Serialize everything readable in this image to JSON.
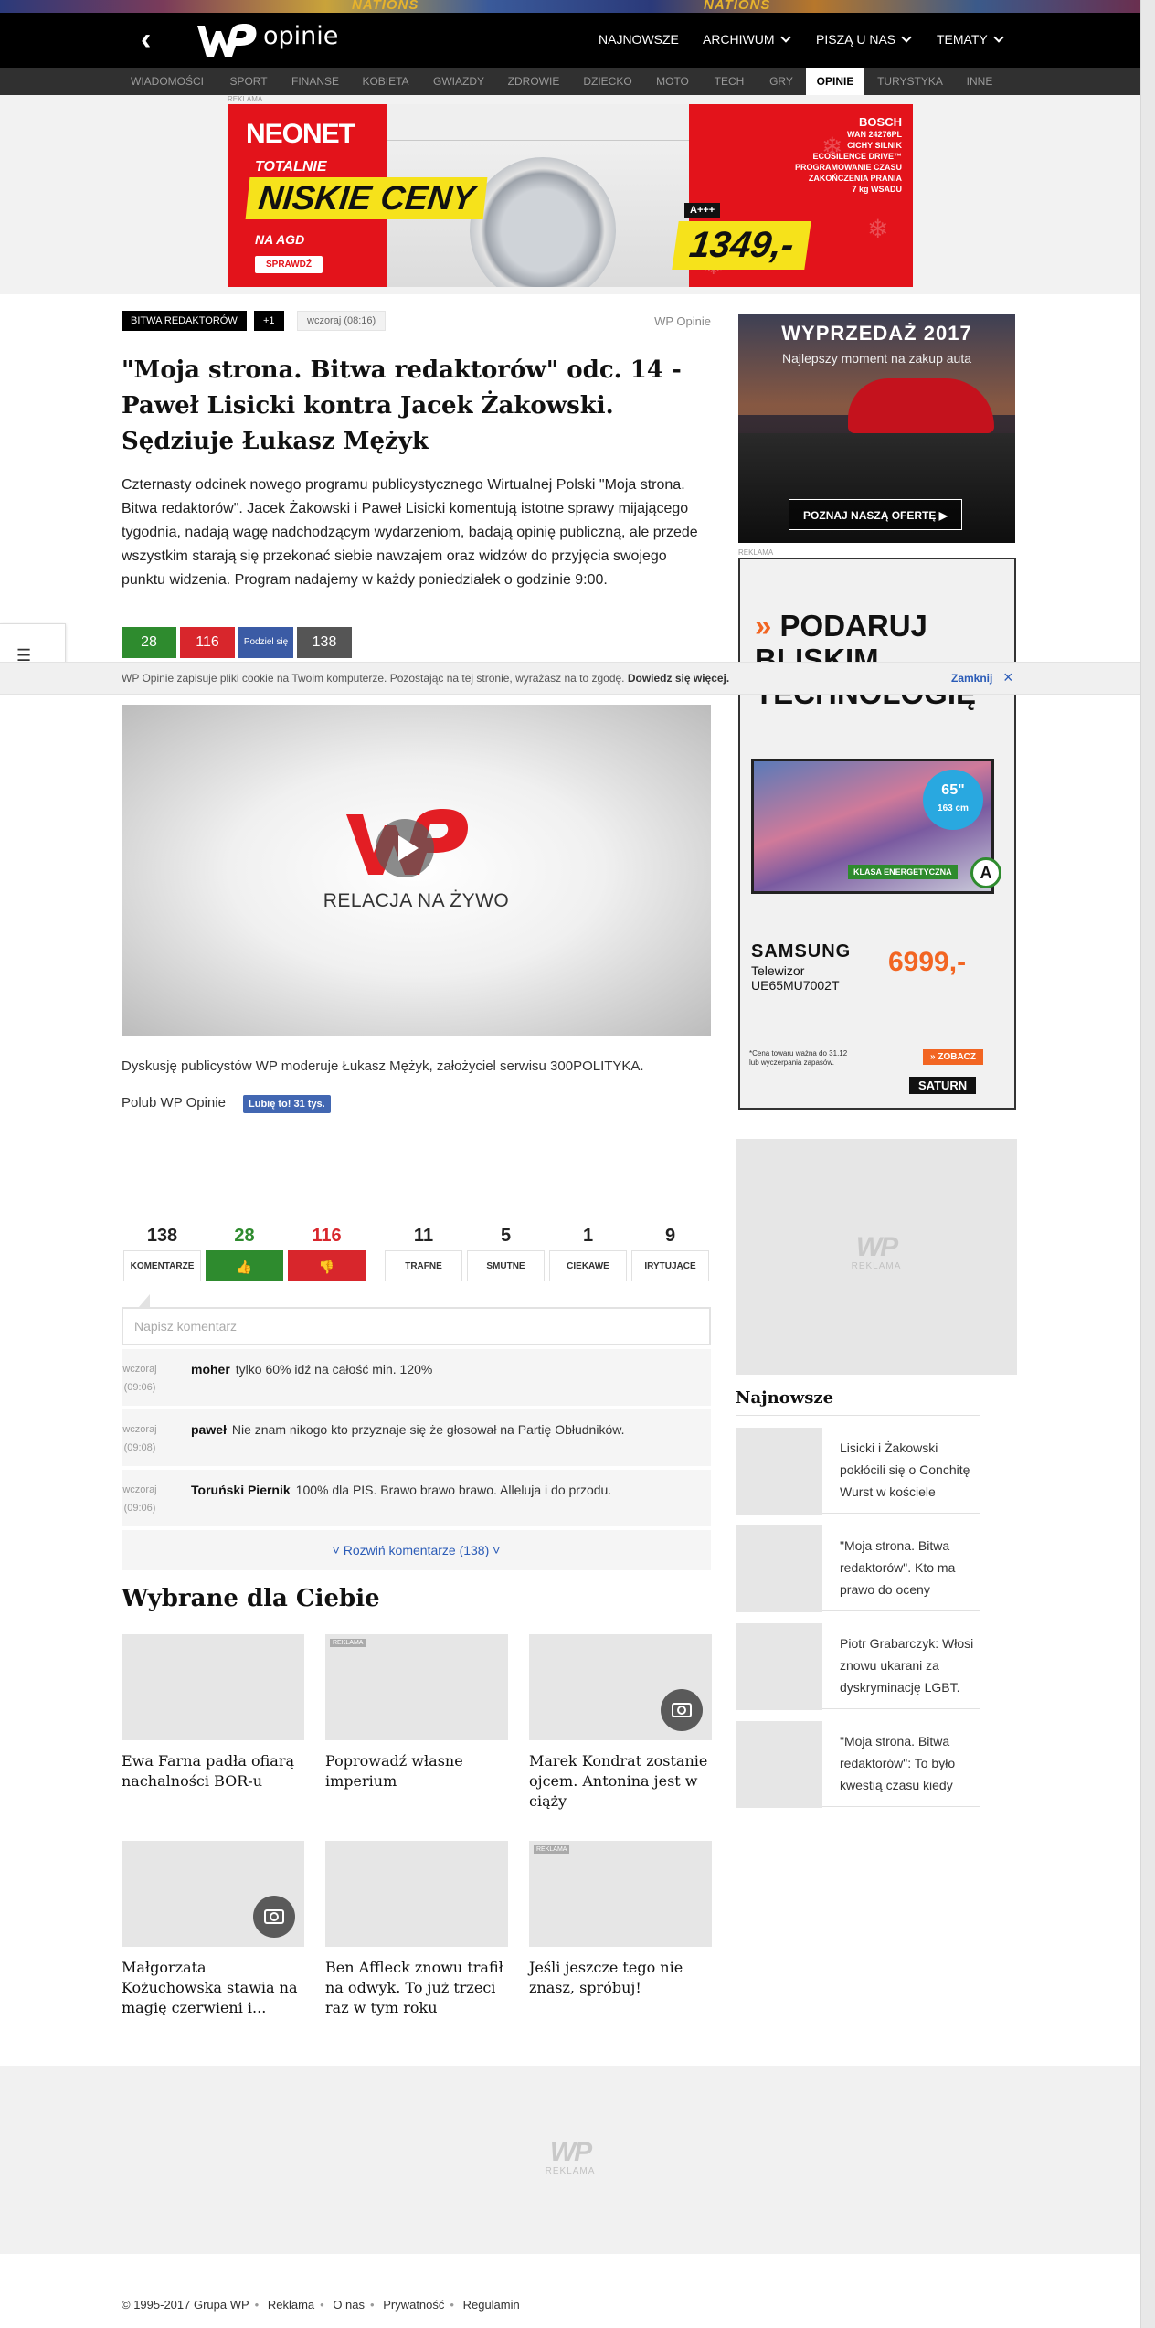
{
  "top_strip": {
    "left_text": "NATIONS",
    "right_text": "NATIONS"
  },
  "header": {
    "back_label": "‹",
    "logo_text": "opinie",
    "nav": [
      {
        "label": "NAJNOWSZE",
        "has_dropdown": false
      },
      {
        "label": "ARCHIWUM",
        "has_dropdown": true
      },
      {
        "label": "PISZĄ U NAS",
        "has_dropdown": true
      },
      {
        "label": "TEMATY",
        "has_dropdown": true
      }
    ]
  },
  "subnav": {
    "items": [
      "WIADOMOŚCI",
      "SPORT",
      "FINANSE",
      "KOBIETA",
      "GWIAZDY",
      "ZDROWIE",
      "DZIECKO",
      "MOTO",
      "TECH",
      "GRY",
      "OPINIE",
      "TURYSTYKA",
      "INNE"
    ],
    "active": "OPINIE"
  },
  "top_ad": {
    "label": "REKLAMA",
    "brand": "NEONET",
    "line1": "TOTALNIE",
    "headline": "NISKIE CENY",
    "line2": "NA AGD",
    "cta": "SPRAWDŹ",
    "product_brand": "BOSCH",
    "product_model": "WAN 24276PL",
    "features": [
      "CICHY SILNIK",
      "ECOSILENCE DRIVE™",
      "PROGRAMOWANIE CZASU",
      "ZAKOŃCZENIA PRANIA",
      "7 kg WSADU"
    ],
    "energy": "A+++",
    "price": "1349,-"
  },
  "article": {
    "tags": [
      "BITWA REDAKTORÓW",
      "+1"
    ],
    "date": "wczoraj (08:16)",
    "source": "WP Opinie",
    "title": "\"Moja strona. Bitwa redaktorów\" odc. 14 - Paweł Lisicki kontra Jacek Żakowski. Sędziuje Łukasz Mężyk",
    "lead": "Czternasty odcinek nowego programu publicystycznego Wirtualnej Polski \"Moja strona. Bitwa redaktorów\". Jacek Żakowski i Paweł Lisicki komentują istotne sprawy mijającego tygodnia, nadają wagę nadchodzącym wydarzeniom, badają opinię publiczną, ale przede wszystkim starają się przekonać siebie nawzajem oraz widzów do przyjęcia swojego punktu widzenia. Program nadajemy w każdy poniedziałek o godzinie 9:00.",
    "votes": {
      "likes": "28",
      "dislikes": "116",
      "share_label": "Podziel się",
      "comments": "138"
    },
    "video_label": "RELACJA NA ŻYWO",
    "caption": "Dyskusję publicystów WP moderuje Łukasz Mężyk, założyciel serwisu 300POLITYKA.",
    "fb_text": "Polub WP Opinie",
    "fb_button": "Lubię to! 31 tys."
  },
  "cookie_bar": {
    "text": "WP Opinie zapisuje pliki cookie na Twoim komputerze. Pozostając na tej stronie, wyrażasz na to zgodę.",
    "more": "Dowiedz się więcej.",
    "close": "Zamknij",
    "close_icon": "×"
  },
  "reactions": [
    {
      "count": "138",
      "label": "KOMENTARZE",
      "kind": "comments"
    },
    {
      "count": "28",
      "label": "👍",
      "kind": "like"
    },
    {
      "count": "116",
      "label": "👎",
      "kind": "dislike"
    },
    {
      "count": "11",
      "label": "TRAFNE",
      "kind": "plain"
    },
    {
      "count": "5",
      "label": "SMUTNE",
      "kind": "plain"
    },
    {
      "count": "1",
      "label": "CIEKAWE",
      "kind": "plain"
    },
    {
      "count": "9",
      "label": "IRYTUJĄCE",
      "kind": "plain"
    }
  ],
  "comment_input": {
    "placeholder": "Napisz komentarz"
  },
  "comments": [
    {
      "time": "wczoraj (09:06)",
      "author": "moher",
      "text": "tylko 60% idź na całość min. 120%"
    },
    {
      "time": "wczoraj (09:08)",
      "author": "paweł",
      "text": "Nie znam nikogo kto przyznaje się że głosował na Partię Obłudników."
    },
    {
      "time": "wczoraj (09:06)",
      "author": "Toruński Piernik",
      "text": "100% dla PIS. Brawo brawo brawo. Alleluja i do przodu."
    }
  ],
  "expand_comments": "˅ Rozwiń komentarze (138) ˅",
  "picked": {
    "heading": "Wybrane dla Ciebie",
    "cards": [
      {
        "title": "Ewa Farna padła ofiarą nachalności BOR-u",
        "ad": false,
        "gallery": false
      },
      {
        "title": "Poprowadź własne imperium",
        "ad": true,
        "gallery": false
      },
      {
        "title": "Marek Kondrat zostanie ojcem. Antonina jest w ciąży",
        "ad": false,
        "gallery": true
      },
      {
        "title": "Małgorzata Kożuchowska stawia na magię czerwieni i...",
        "ad": false,
        "gallery": true
      },
      {
        "title": "Ben Affleck znowu trafił na odwyk. To już trzeci raz w tym roku",
        "ad": false,
        "gallery": false
      },
      {
        "title": "Jeśli jeszcze tego nie znasz, spróbuj!",
        "ad": true,
        "gallery": false
      }
    ],
    "ad_badge": "REKLAMA"
  },
  "sidebar": {
    "ad1": {
      "headline": "WYPRZEDAŻ 2017",
      "sub": "Najlepszy moment na zakup auta",
      "cta": "POZNAJ NASZĄ OFERTĘ ▶"
    },
    "ad2_label": "REKLAMA",
    "ad2": {
      "headline": [
        "PODARUJ",
        "BLISKIM",
        "TECHNOLOGIĘ"
      ],
      "arrows": "»",
      "size": "65\"",
      "size_cm": "163 cm",
      "energy_label": "KLASA ENERGETYCZNA",
      "energy_class": "A",
      "brand": "SAMSUNG",
      "model": [
        "Telewizor",
        "UE65MU7002T"
      ],
      "price": "6999,-",
      "note": [
        "*Cena towaru ważna do 31.12",
        "lub wyczerpania zapasów."
      ],
      "cta": "» ZOBACZ",
      "store": "SATURN"
    },
    "placeholder_label": "REKLAMA",
    "newest_heading": "Najnowsze",
    "newest": [
      "Lisicki i Żakowski pokłócili się o Conchitę Wurst w kościele",
      "\"Moja strona. Bitwa redaktorów\". Kto ma prawo do oceny",
      "Piotr Grabarczyk: Włosi znowu ukarani za dyskryminację LGBT.",
      "\"Moja strona. Bitwa redaktorów\": To było kwestią czasu kiedy"
    ]
  },
  "bottom_ad": {
    "label": "REKLAMA"
  },
  "footer": {
    "items": [
      "© 1995-2017 Grupa WP",
      "Reklama",
      "O nas",
      "Prywatność",
      "Regulamin"
    ]
  }
}
